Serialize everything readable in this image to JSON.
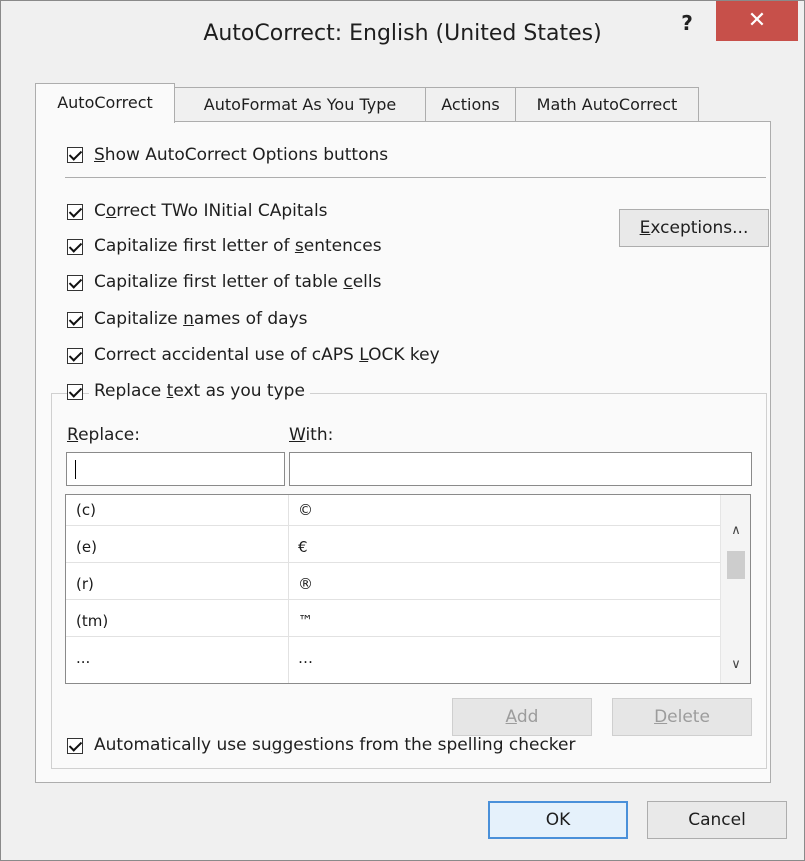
{
  "window": {
    "title": "AutoCorrect: English (United States)",
    "help_label": "?",
    "close_label": "✕"
  },
  "tabs": [
    {
      "label": "AutoCorrect",
      "active": true
    },
    {
      "label": "AutoFormat As You Type",
      "active": false
    },
    {
      "label": "Actions",
      "active": false
    },
    {
      "label": "Math AutoCorrect",
      "active": false
    }
  ],
  "options": {
    "show_buttons": {
      "pre": "",
      "u": "S",
      "post": "how AutoCorrect Options buttons",
      "checked": true
    },
    "two_initials": {
      "pre": "C",
      "u": "o",
      "post": "rrect TWo INitial CApitals",
      "checked": true
    },
    "first_letter_sentences": {
      "pre": "Capitalize first letter of ",
      "u": "s",
      "post": "entences",
      "checked": true
    },
    "first_letter_cells": {
      "pre": "Capitalize first letter of table ",
      "u": "c",
      "post": "ells",
      "checked": true
    },
    "names_of_days": {
      "pre": "Capitalize ",
      "u": "n",
      "post": "ames of days",
      "checked": true
    },
    "caps_lock": {
      "pre": "Correct accidental use of cAPS ",
      "u": "L",
      "post": "OCK key",
      "checked": true
    },
    "replace_text": {
      "pre": "Replace ",
      "u": "t",
      "post": "ext as you type",
      "checked": true
    },
    "use_suggestions": {
      "pre": "Automatically use su",
      "u": "g",
      "post": "gestions from the spelling checker",
      "checked": true
    }
  },
  "exceptions_button": {
    "pre": "",
    "u": "E",
    "post": "xceptions..."
  },
  "replace_section": {
    "replace_label": {
      "pre": "",
      "u": "R",
      "post": "eplace:"
    },
    "with_label": {
      "pre": "",
      "u": "W",
      "post": "ith:"
    },
    "replace_value": "",
    "with_value": "",
    "entries": [
      {
        "replace": "(c)",
        "with": "©"
      },
      {
        "replace": "(e)",
        "with": "€"
      },
      {
        "replace": "(r)",
        "with": "®"
      },
      {
        "replace": "(tm)",
        "with": "™"
      },
      {
        "replace": "...",
        "with": "…"
      }
    ],
    "add_button": {
      "pre": "",
      "u": "A",
      "post": "dd"
    },
    "delete_button": {
      "pre": "",
      "u": "D",
      "post": "elete"
    }
  },
  "footer": {
    "ok_label": "OK",
    "cancel_label": "Cancel"
  }
}
